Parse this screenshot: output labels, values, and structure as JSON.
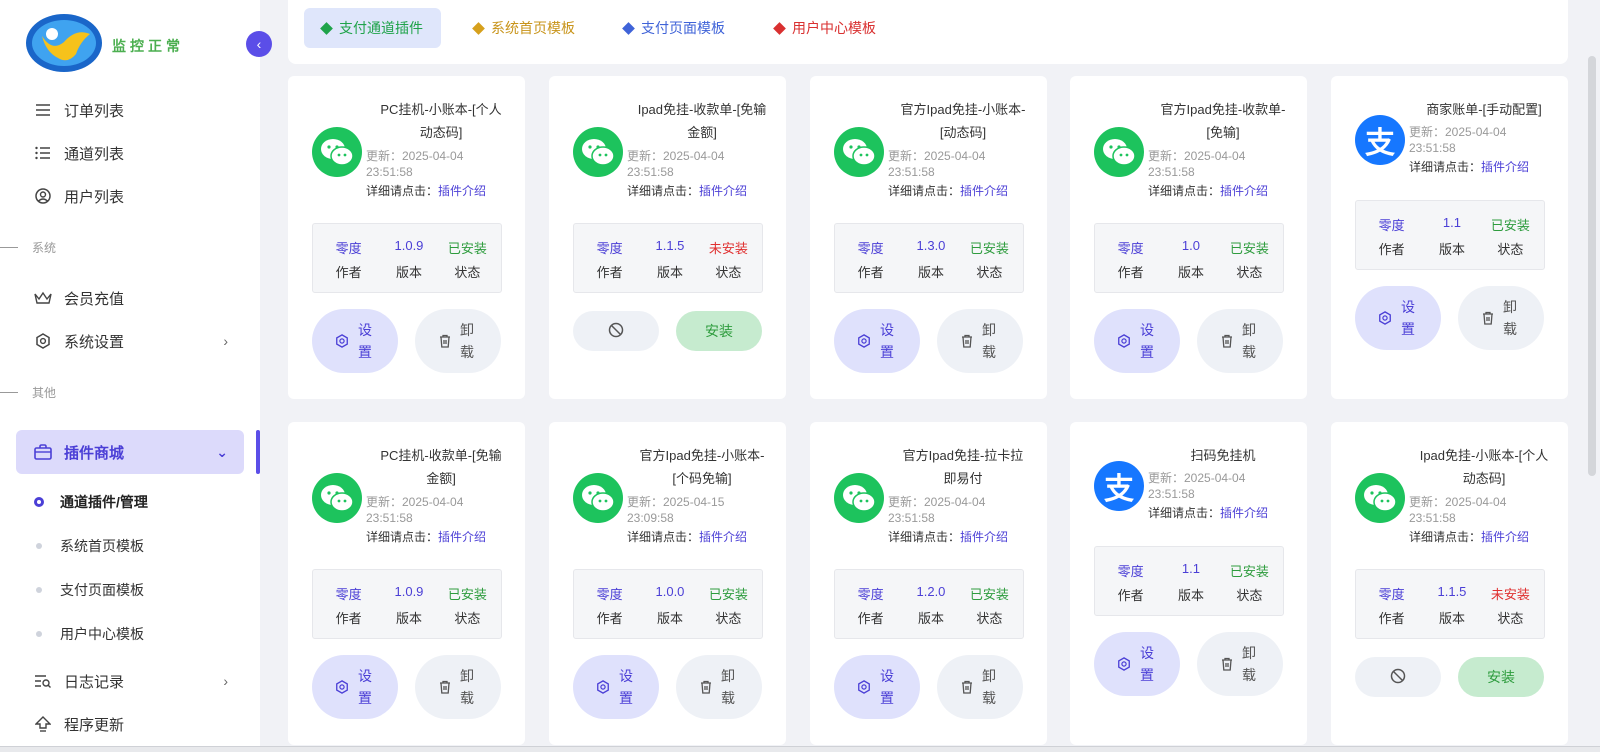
{
  "brand": "监控正常",
  "sidebar": {
    "items": [
      {
        "label": "订单列表"
      },
      {
        "label": "通道列表"
      },
      {
        "label": "用户列表"
      }
    ],
    "section_system": "系统",
    "system_items": [
      {
        "label": "会员充值"
      },
      {
        "label": "系统设置"
      }
    ],
    "section_other": "其他",
    "plugin_store": "插件商城",
    "sub_items": [
      {
        "label": "通道插件/管理"
      },
      {
        "label": "系统首页模板"
      },
      {
        "label": "支付页面模板"
      },
      {
        "label": "用户中心模板"
      }
    ],
    "log": "日志记录",
    "update": "程序更新"
  },
  "tabs": [
    {
      "label": "支付通道插件",
      "color": "#1fa34a"
    },
    {
      "label": "系统首页模板",
      "color": "#d6a01c"
    },
    {
      "label": "支付页面模板",
      "color": "#3f63d8"
    },
    {
      "label": "用户中心模板",
      "color": "#d93030"
    }
  ],
  "labels": {
    "detail": "详细请点击：",
    "detail_link": "插件介绍",
    "author": "作者",
    "version": "版本",
    "status": "状态",
    "set_1": "设",
    "set_2": "置",
    "del_1": "卸",
    "del_2": "载",
    "install": "安装"
  },
  "plugins": [
    {
      "title_1": "PC挂机-小账本-[个人",
      "title_2": "动态码]",
      "updated_1": "更新：2025-04-04",
      "updated_2": "23:51:58",
      "author": "零度",
      "version": "1.0.9",
      "status": "已安装",
      "installed": true,
      "icon": "wechat"
    },
    {
      "title_1": "Ipad免挂-收款单-[免输",
      "title_2": "金额]",
      "updated_1": "更新：2025-04-04",
      "updated_2": "23:51:58",
      "author": "零度",
      "version": "1.1.5",
      "status": "未安装",
      "installed": false,
      "icon": "wechat"
    },
    {
      "title_1": "官方Ipad免挂-小账本-",
      "title_2": "[动态码]",
      "updated_1": "更新：2025-04-04",
      "updated_2": "23:51:58",
      "author": "零度",
      "version": "1.3.0",
      "status": "已安装",
      "installed": true,
      "icon": "wechat"
    },
    {
      "title_1": "官方Ipad免挂-收款单-",
      "title_2": "[免输]",
      "updated_1": "更新：2025-04-04",
      "updated_2": "23:51:58",
      "author": "零度",
      "version": "1.0",
      "status": "已安装",
      "installed": true,
      "icon": "wechat"
    },
    {
      "title_1": "商家账单-[手动配置]",
      "title_2": "",
      "updated_1": "更新：2025-04-04",
      "updated_2": "23:51:58",
      "author": "零度",
      "version": "1.1",
      "status": "已安装",
      "installed": true,
      "icon": "alipay"
    },
    {
      "title_1": "PC挂机-收款单-[免输",
      "title_2": "金额]",
      "updated_1": "更新：2025-04-04",
      "updated_2": "23:51:58",
      "author": "零度",
      "version": "1.0.9",
      "status": "已安装",
      "installed": true,
      "icon": "wechat"
    },
    {
      "title_1": "官方Ipad免挂-小账本-",
      "title_2": "[个码免输]",
      "updated_1": "更新：2025-04-15",
      "updated_2": "23:09:58",
      "author": "零度",
      "version": "1.0.0",
      "status": "已安装",
      "installed": true,
      "icon": "wechat"
    },
    {
      "title_1": "官方Ipad免挂-拉卡拉",
      "title_2": "即易付",
      "updated_1": "更新：2025-04-04",
      "updated_2": "23:51:58",
      "author": "零度",
      "version": "1.2.0",
      "status": "已安装",
      "installed": true,
      "icon": "wechat"
    },
    {
      "title_1": "扫码免挂机",
      "title_2": "",
      "updated_1": "更新：2025-04-04",
      "updated_2": "23:51:58",
      "author": "零度",
      "version": "1.1",
      "status": "已安装",
      "installed": true,
      "icon": "alipay"
    },
    {
      "title_1": "Ipad免挂-小账本-[个人",
      "title_2": "动态码]",
      "updated_1": "更新：2025-04-04",
      "updated_2": "23:51:58",
      "author": "零度",
      "version": "1.1.5",
      "status": "未安装",
      "installed": false,
      "icon": "wechat"
    }
  ]
}
